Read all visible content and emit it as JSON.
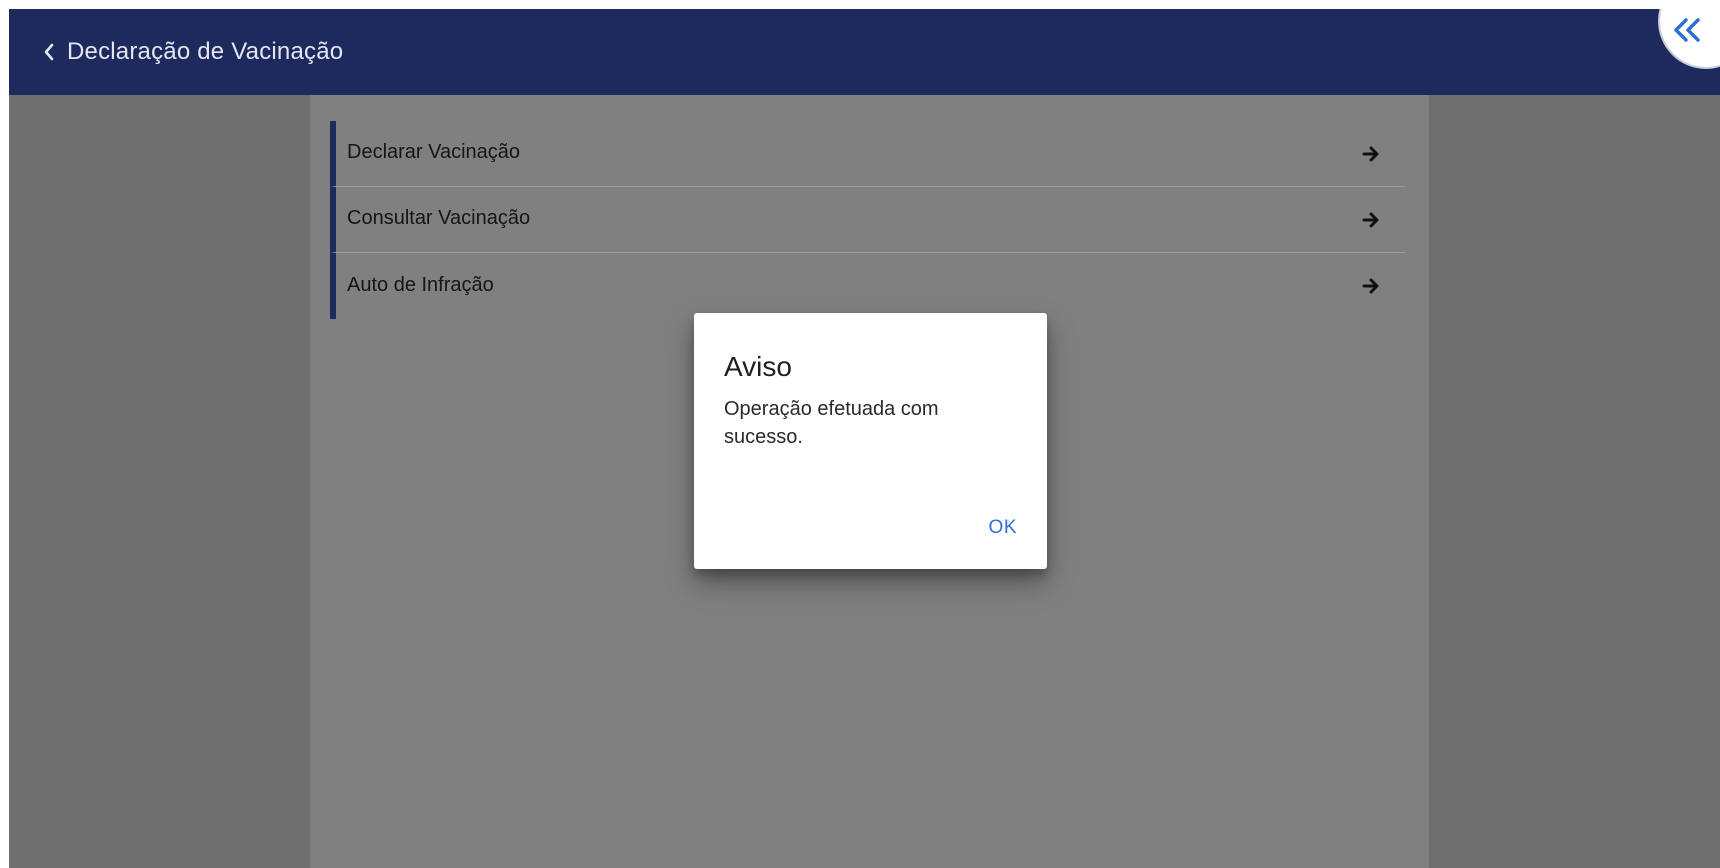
{
  "header": {
    "title": "Declaração de Vacinação",
    "back_icon": "chevron-left-icon",
    "corner_icon": "double-chevron-left-icon",
    "background_color": "#1e2a5e"
  },
  "menu": {
    "items": [
      {
        "label": "Declarar Vacinação",
        "icon": "arrow-right-icon"
      },
      {
        "label": "Consultar Vacinação",
        "icon": "arrow-right-icon"
      },
      {
        "label": "Auto de Infração",
        "icon": "arrow-right-icon"
      }
    ],
    "accent_color": "#1e2a5e"
  },
  "dialog": {
    "title": "Aviso",
    "message": "Operação efetuada com sucesso.",
    "ok_label": "OK",
    "button_color": "#2f6fd6"
  }
}
